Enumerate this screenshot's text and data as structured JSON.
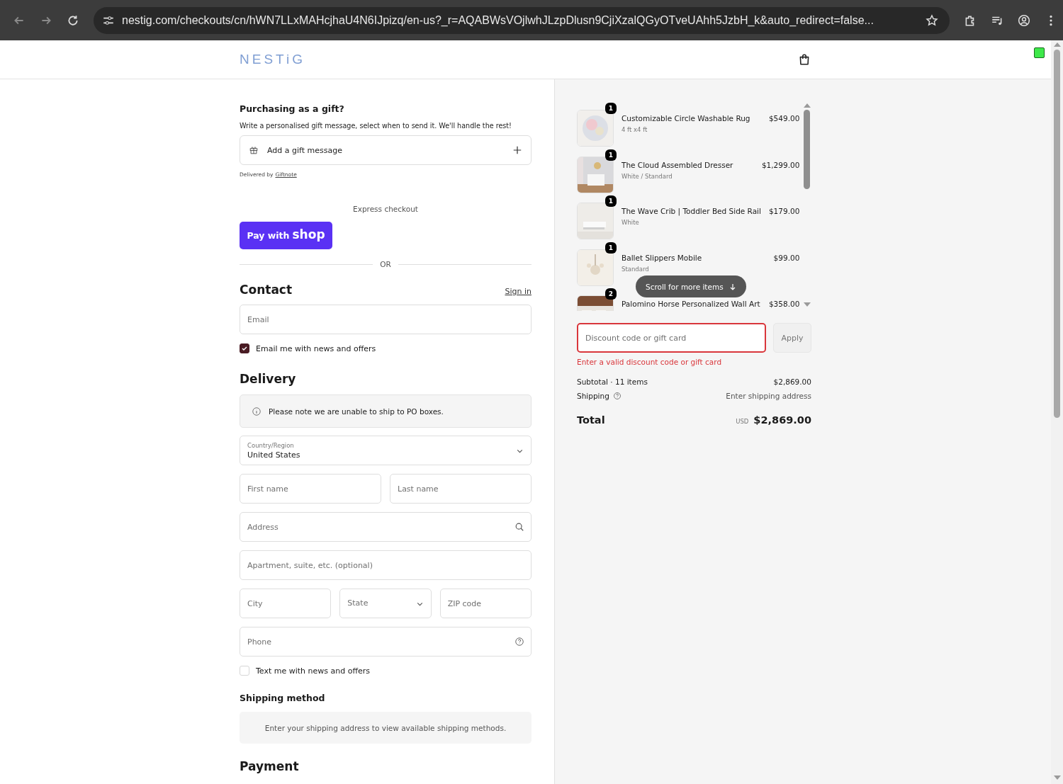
{
  "browser": {
    "url": "nestig.com/checkouts/cn/hWN7LLxMAHcjhaU4N6IJpizq/en-us?_r=AQABWsVOjlwhJLzpDlusn9CjiXzalQGyOTveUAhh5JzbH_k&auto_redirect=false..."
  },
  "header": {
    "logo": "NESTiG"
  },
  "gift": {
    "title": "Purchasing as a gift?",
    "subtitle": "Write a personalised gift message, select when to send it. We'll handle the rest!",
    "button": "Add a gift message",
    "delivered_by": "Delivered by",
    "delivered_link": "Giftnote"
  },
  "express": {
    "label": "Express checkout",
    "pay_prefix": "Pay with",
    "pay_brand": "shop",
    "divider": "OR"
  },
  "contact": {
    "title": "Contact",
    "sign_in": "Sign in",
    "email": {
      "placeholder": "Email"
    },
    "news": {
      "label": "Email me with news and offers",
      "checked": true
    }
  },
  "delivery": {
    "title": "Delivery",
    "notice": "Please note we are unable to ship to PO boxes.",
    "country": {
      "label": "Country/Region",
      "value": "United States"
    },
    "fields": [
      {
        "items": [
          {
            "kind": "text",
            "placeholder": "First name"
          },
          {
            "kind": "text",
            "placeholder": "Last name"
          }
        ]
      },
      {
        "items": [
          {
            "kind": "search",
            "placeholder": "Address"
          }
        ]
      },
      {
        "items": [
          {
            "kind": "text",
            "placeholder": "Apartment, suite, etc. (optional)"
          }
        ]
      },
      {
        "items": [
          {
            "kind": "text",
            "placeholder": "City"
          },
          {
            "kind": "select",
            "placeholder": "State"
          },
          {
            "kind": "text",
            "placeholder": "ZIP code"
          }
        ]
      },
      {
        "items": [
          {
            "kind": "help",
            "placeholder": "Phone"
          }
        ]
      }
    ],
    "sms": {
      "label": "Text me with news and offers",
      "checked": false
    }
  },
  "shipping_method": {
    "title": "Shipping method",
    "message": "Enter your shipping address to view available shipping methods."
  },
  "payment": {
    "title": "Payment"
  },
  "cart": {
    "items": [
      {
        "name": "Customizable Circle Washable Rug",
        "variant": "4 ft x4 ft",
        "price": "$549.00",
        "quantity": "1"
      },
      {
        "name": "The Cloud Assembled Dresser",
        "variant": "White / Standard",
        "price": "$1,299.00",
        "quantity": "1"
      },
      {
        "name": "The Wave Crib | Toddler Bed Side Rail",
        "variant": "White",
        "price": "$179.00",
        "quantity": "1"
      },
      {
        "name": "Ballet Slippers Mobile",
        "variant": "Standard",
        "price": "$99.00",
        "quantity": "1"
      },
      {
        "name": "Palomino Horse Personalized Wall Art",
        "price": "$358.00",
        "quantity": "2"
      }
    ],
    "scroll_hint": "Scroll for more items",
    "discount": {
      "placeholder": "Discount code or gift card",
      "invalid": true,
      "error": "Enter a valid discount code or gift card",
      "button": "Apply"
    },
    "subtotal_label": "Subtotal · 11 items",
    "subtotal": "$2,869.00",
    "shipping_label": "Shipping",
    "shipping_value": "Enter shipping address",
    "total_label": "Total",
    "currency": "USD",
    "total": "$2,869.00"
  }
}
